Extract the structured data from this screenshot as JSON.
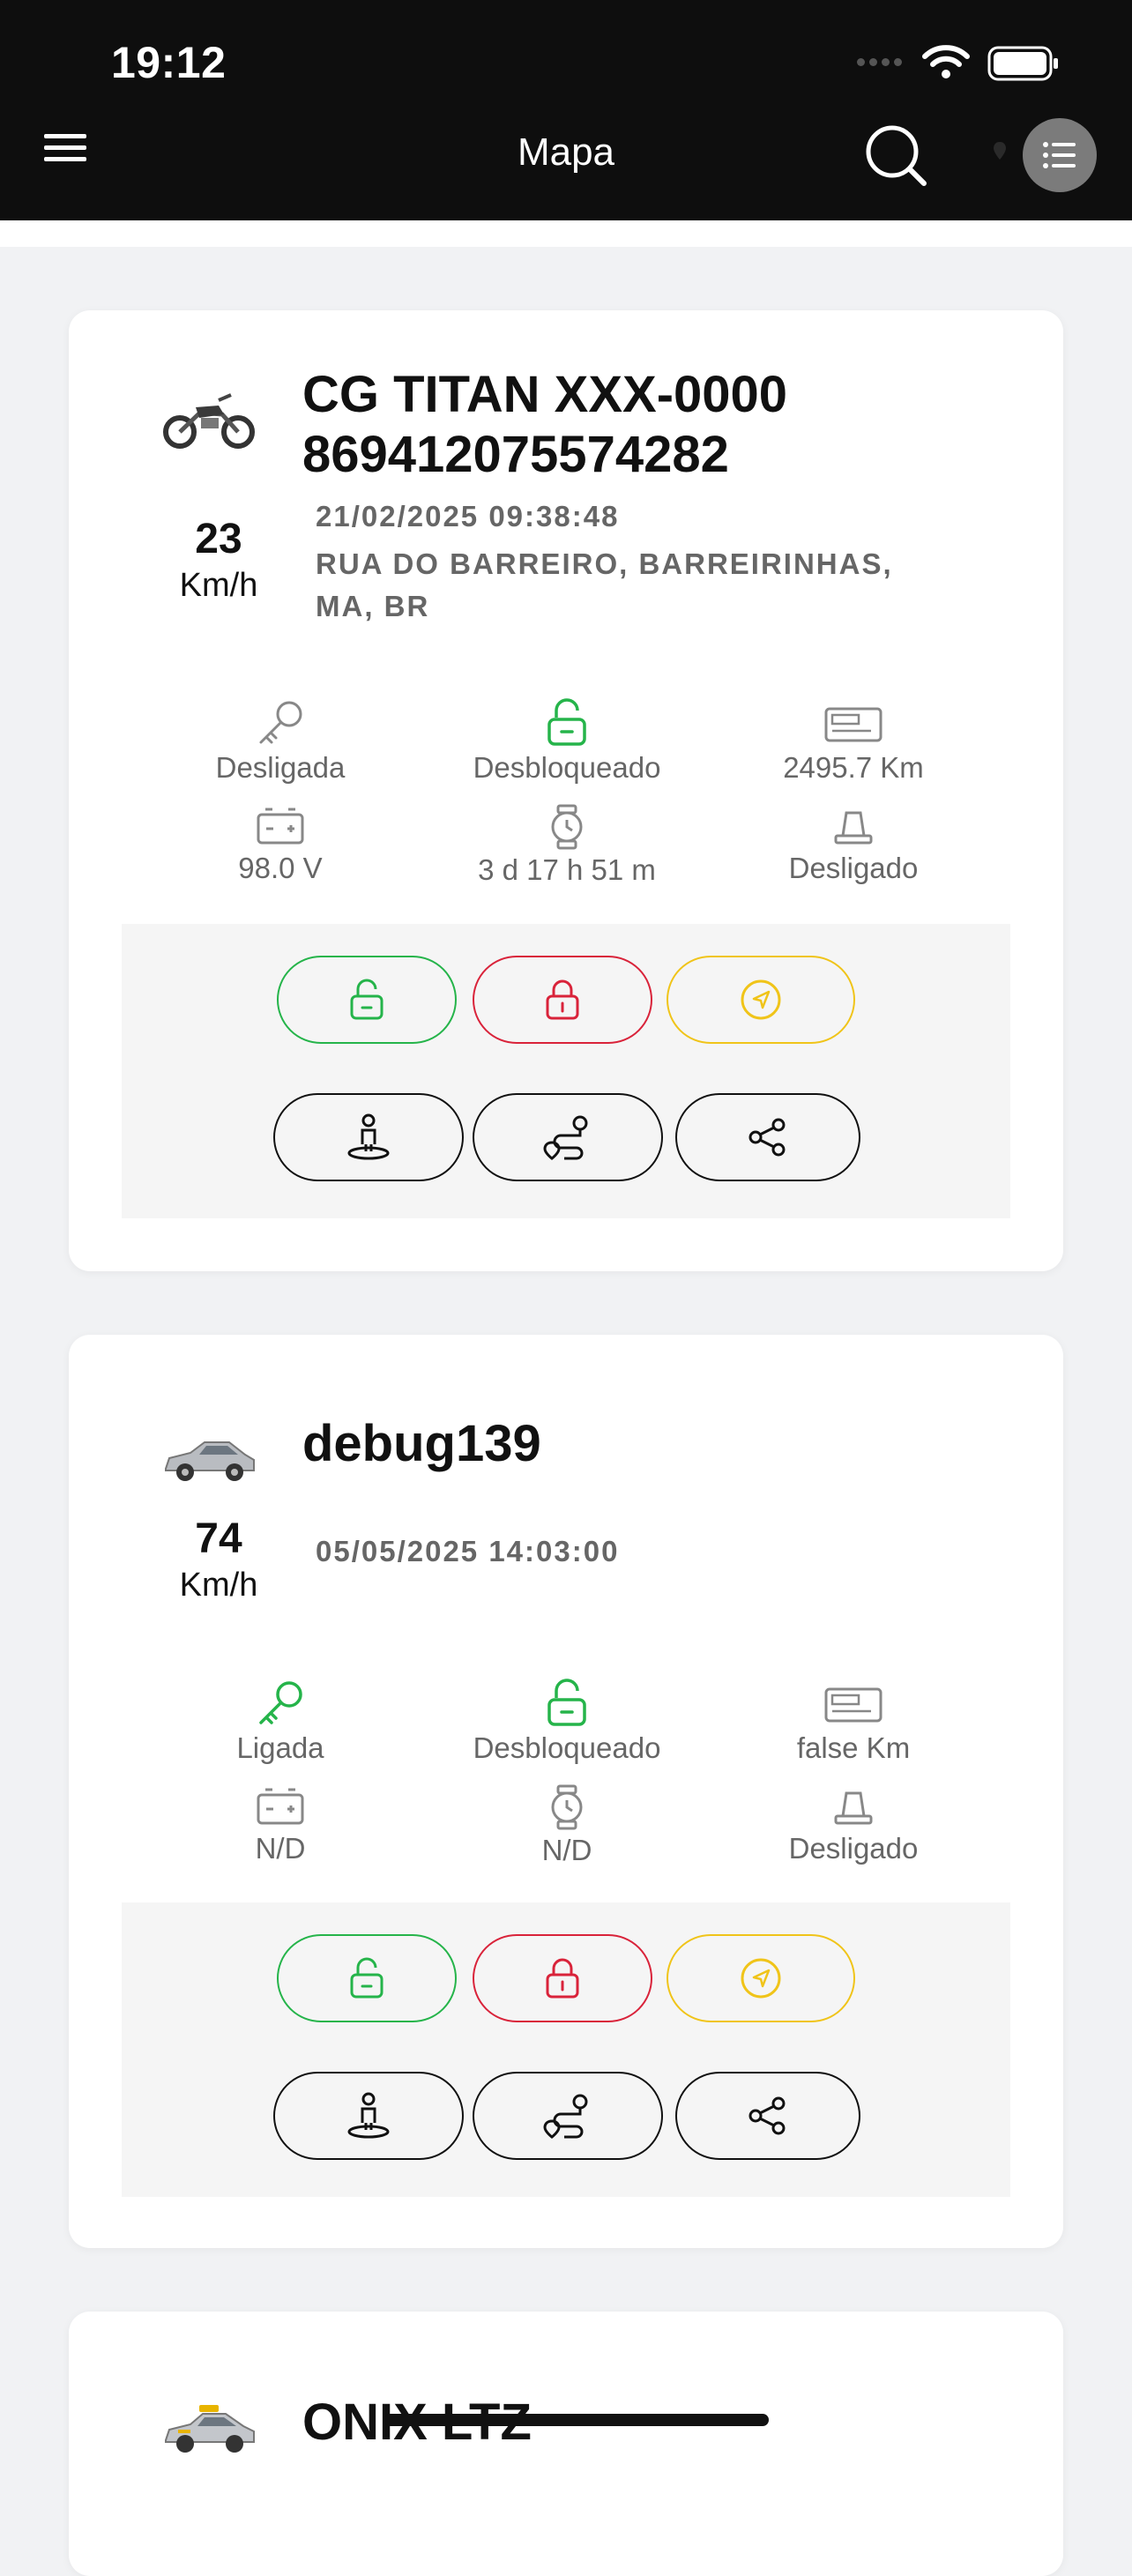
{
  "status_bar": {
    "time": "19:12"
  },
  "header": {
    "title": "Mapa"
  },
  "colors": {
    "green": "#25b44a",
    "red": "#d9233a",
    "yellow": "#f0c419",
    "muted": "#666666"
  },
  "vehicles": [
    {
      "icon": "motorcycle-icon",
      "name": "CG TITAN XXX-0000",
      "imei": "869412075574282",
      "speed": "23",
      "speed_unit": "Km/h",
      "datetime": "21/02/2025 09:38:48",
      "address_line1": "RUA DO BARREIRO, BARREIRINHAS,",
      "address_line2": "MA, BR",
      "ignition": "Desligada",
      "lock": "Desbloqueado",
      "odometer": "2495.7 Km",
      "voltage": "98.0 V",
      "hourmeter": "3 d 17 h 51 m",
      "siren": "Desligado"
    },
    {
      "icon": "car-icon",
      "name": "debug139",
      "speed": "74",
      "speed_unit": "Km/h",
      "datetime": "05/05/2025 14:03:00",
      "ignition": "Ligada",
      "lock": "Desbloqueado",
      "odometer": "false Km",
      "voltage": "N/D",
      "hourmeter": "N/D",
      "siren": "Desligado"
    },
    {
      "icon": "taxi-icon",
      "name": "ONIX LTZ"
    }
  ]
}
